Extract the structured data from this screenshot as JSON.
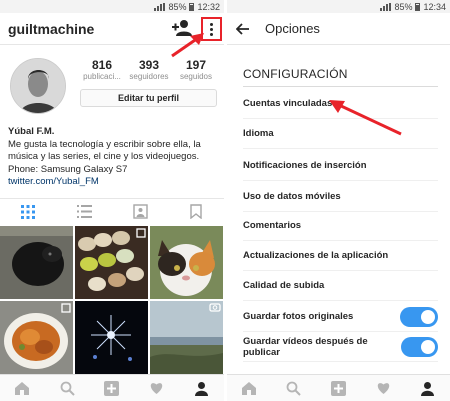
{
  "left_phone": {
    "status": {
      "battery": "85%",
      "time": "12:32"
    },
    "header": {
      "username": "guiltmachine"
    },
    "profile": {
      "stats": [
        {
          "value": "816",
          "label": "publicaci..."
        },
        {
          "value": "393",
          "label": "seguidores"
        },
        {
          "value": "197",
          "label": "seguidos"
        }
      ],
      "edit_button": "Editar tu perfil"
    },
    "bio": {
      "name": "Yúbal F.M.",
      "line1": "Me gusta la tecnología y escribir sobre ella, la",
      "line2": "música y las series, el cine y los videojuegos.",
      "line3": "Phone: Samsung Galaxy S7",
      "link": "twitter.com/Yubal_FM"
    },
    "profile_tabs": [
      "grid-icon",
      "list-icon",
      "tagged-icon",
      "bookmark-icon"
    ],
    "bottom_nav": [
      "home-icon",
      "search-icon",
      "add-icon",
      "heart-icon",
      "profile-icon"
    ]
  },
  "right_phone": {
    "status": {
      "battery": "85%",
      "time": "12:34"
    },
    "header": {
      "title": "Opciones"
    },
    "section_title": "CONFIGURACIÓN",
    "rows": [
      {
        "label": "Cuentas vinculadas"
      },
      {
        "label": "Idioma"
      },
      {
        "label": "Notificaciones de inserción"
      },
      {
        "label": "Uso de datos móviles"
      },
      {
        "label": "Comentarios"
      },
      {
        "label": "Actualizaciones de la aplicación"
      },
      {
        "label": "Calidad de subida"
      },
      {
        "label": "Guardar fotos originales",
        "toggle": true,
        "on": true
      },
      {
        "label": "Guardar vídeos después de publicar",
        "toggle": true,
        "on": true
      }
    ],
    "bottom_nav": [
      "home-icon",
      "search-icon",
      "add-icon",
      "heart-icon",
      "profile-icon"
    ]
  },
  "colors": {
    "accent": "#3897f0",
    "annotation_red": "#e8232a",
    "text": "#262626",
    "muted": "#8e8e8e"
  }
}
